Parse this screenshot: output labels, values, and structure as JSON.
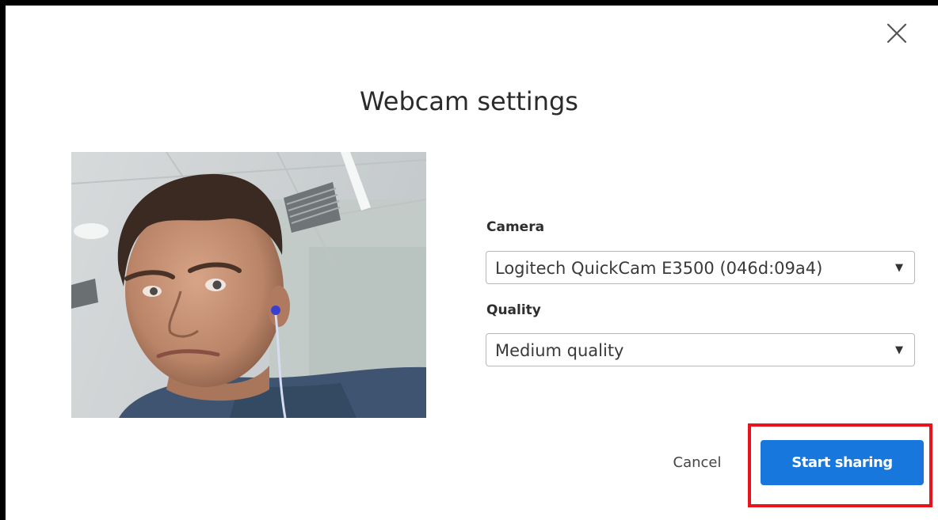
{
  "dialog": {
    "title": "Webcam settings",
    "close_icon": "close-icon"
  },
  "preview": {
    "icon": "webcam-preview-image"
  },
  "camera": {
    "label": "Camera",
    "selected": "Logitech QuickCam E3500 (046d:09a4)"
  },
  "quality": {
    "label": "Quality",
    "selected": "Medium quality"
  },
  "actions": {
    "cancel_label": "Cancel",
    "start_label": "Start sharing"
  },
  "colors": {
    "primary": "#1877dc",
    "highlight": "#e8131b",
    "overlay": "#000000"
  }
}
